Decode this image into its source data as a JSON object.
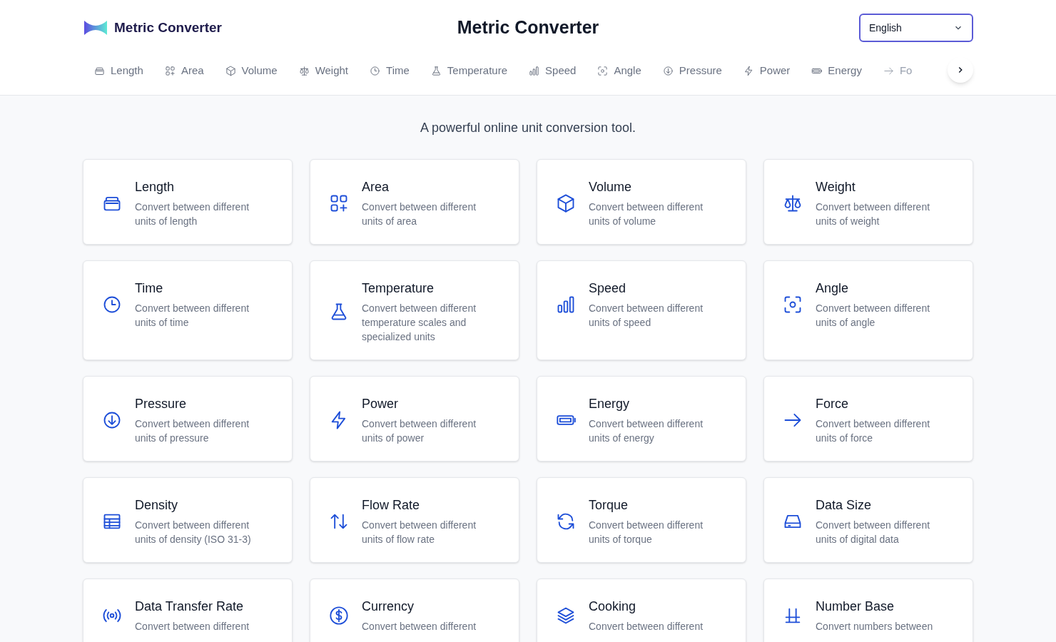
{
  "header": {
    "logo_text": "Metric Converter",
    "title": "Metric Converter",
    "language_select": {
      "value": "English"
    }
  },
  "nav": [
    {
      "label": "Length"
    },
    {
      "label": "Area"
    },
    {
      "label": "Volume"
    },
    {
      "label": "Weight"
    },
    {
      "label": "Time"
    },
    {
      "label": "Temperature"
    },
    {
      "label": "Speed"
    },
    {
      "label": "Angle"
    },
    {
      "label": "Pressure"
    },
    {
      "label": "Power"
    },
    {
      "label": "Energy"
    },
    {
      "label": "Fo"
    }
  ],
  "tagline": "A powerful online unit conversion tool.",
  "cards": [
    {
      "title": "Length",
      "description": "Convert between different units of length"
    },
    {
      "title": "Area",
      "description": "Convert between different units of area"
    },
    {
      "title": "Volume",
      "description": "Convert between different units of volume"
    },
    {
      "title": "Weight",
      "description": "Convert between different units of weight"
    },
    {
      "title": "Time",
      "description": "Convert between different units of time"
    },
    {
      "title": "Temperature",
      "description": "Convert between different temperature scales and specialized units"
    },
    {
      "title": "Speed",
      "description": "Convert between different units of speed"
    },
    {
      "title": "Angle",
      "description": "Convert between different units of angle"
    },
    {
      "title": "Pressure",
      "description": "Convert between different units of pressure"
    },
    {
      "title": "Power",
      "description": "Convert between different units of power"
    },
    {
      "title": "Energy",
      "description": "Convert between different units of energy"
    },
    {
      "title": "Force",
      "description": "Convert between different units of force"
    },
    {
      "title": "Density",
      "description": "Convert between different units of density (ISO 31-3)"
    },
    {
      "title": "Flow Rate",
      "description": "Convert between different units of flow rate"
    },
    {
      "title": "Torque",
      "description": "Convert between different units of torque"
    },
    {
      "title": "Data Size",
      "description": "Convert between different units of digital data"
    },
    {
      "title": "Data Transfer Rate",
      "description": "Convert between different"
    },
    {
      "title": "Currency",
      "description": "Convert between different"
    },
    {
      "title": "Cooking",
      "description": "Convert between different"
    },
    {
      "title": "Number Base",
      "description": "Convert numbers between"
    }
  ]
}
